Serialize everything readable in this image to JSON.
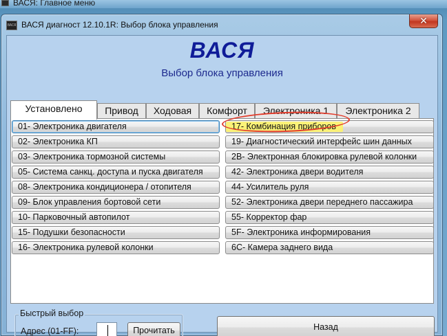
{
  "background_window": {
    "title": "ВАСЯ: Главное меню"
  },
  "window": {
    "title": "ВАСЯ диагност 12.10.1R:  Выбор блока управления",
    "close_glyph": "✕",
    "icon_text": "ВАСЯ"
  },
  "header": {
    "app_title": "ВАСЯ",
    "subtitle": "Выбор блока управления"
  },
  "tabs": [
    {
      "label": "Установлено",
      "active": true
    },
    {
      "label": "Привод",
      "active": false
    },
    {
      "label": "Ходовая",
      "active": false
    },
    {
      "label": "Комфорт",
      "active": false
    },
    {
      "label": "Электроника 1",
      "active": false
    },
    {
      "label": "Электроника 2",
      "active": false
    }
  ],
  "units_left": [
    {
      "label": "01- Электроника двигателя"
    },
    {
      "label": "02- Электроника КП"
    },
    {
      "label": "03- Электроника тормозной системы"
    },
    {
      "label": "05- Система санкц. доступа и пуска двигателя"
    },
    {
      "label": "08- Электроника кондиционера / отопителя"
    },
    {
      "label": "09- Блок управления бортовой сети"
    },
    {
      "label": "10- Парковочный автопилот"
    },
    {
      "label": "15- Подушки безопасности"
    },
    {
      "label": "16- Электроника рулевой колонки"
    }
  ],
  "units_right": [
    {
      "label": "17- Комбинация приборов"
    },
    {
      "label": "19- Диагностический интерфейс шин данных"
    },
    {
      "label": "2B- Электронная блокировка рулевой колонки"
    },
    {
      "label": "42- Электроника двери водителя"
    },
    {
      "label": "44- Усилитель руля"
    },
    {
      "label": "52- Электроника двери переднего пассажира"
    },
    {
      "label": "55- Корректор фар"
    },
    {
      "label": "5F- Электроника информирования"
    },
    {
      "label": "6C- Камера заднего вида"
    }
  ],
  "quick_select": {
    "legend": "Быстрый выбор",
    "address_label": "Адрес (01-FF):",
    "address_value": "",
    "read_label": "Прочитать"
  },
  "footer": {
    "back_label": "Назад"
  },
  "colors": {
    "title_blue": "#0f1c98",
    "highlight_yellow": "#fdf36a",
    "annotation_red": "#e23b2a"
  }
}
